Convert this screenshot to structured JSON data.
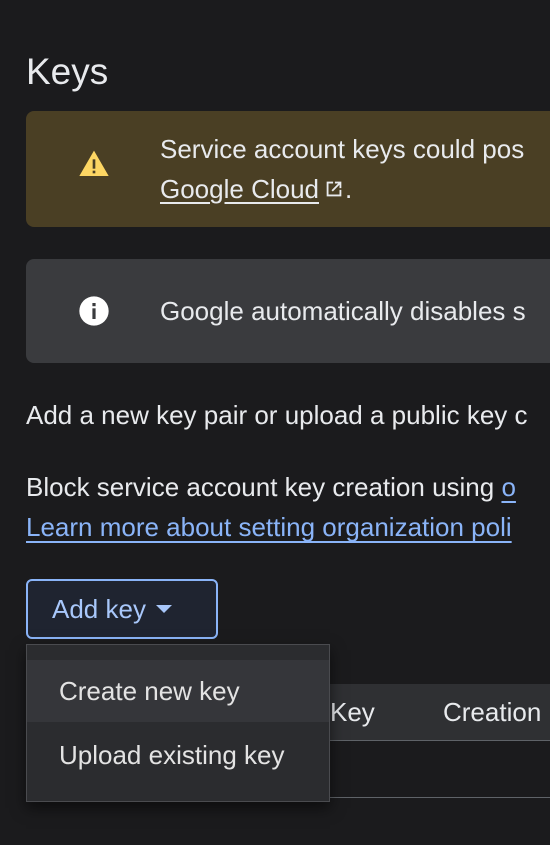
{
  "section": {
    "title": "Keys"
  },
  "warning_banner": {
    "icon": "warning-icon",
    "text_line1": "Service account keys could pos",
    "link_text": "Google Cloud",
    "link_icon": "external-link-icon",
    "after_link": ".",
    "color": "#4a3f24",
    "icon_color": "#fdd663"
  },
  "info_banner": {
    "icon": "info-icon",
    "text": "Google automatically disables s",
    "color": "#3a3b3e"
  },
  "paragraphs": {
    "add_key_text": "Add a new key pair or upload a public key c",
    "block_text": "Block service account key creation using ",
    "block_link": "o",
    "learn_more_link": "Learn more about setting organization poli"
  },
  "add_key_button": {
    "label": "Add key",
    "icon": "caret-down-icon",
    "accent": "#8ab4f8"
  },
  "dropdown_menu": {
    "items": [
      {
        "label": "Create new key"
      },
      {
        "label": "Upload existing key"
      }
    ]
  },
  "keys_table": {
    "columns": [
      "Key",
      "Creation"
    ]
  }
}
